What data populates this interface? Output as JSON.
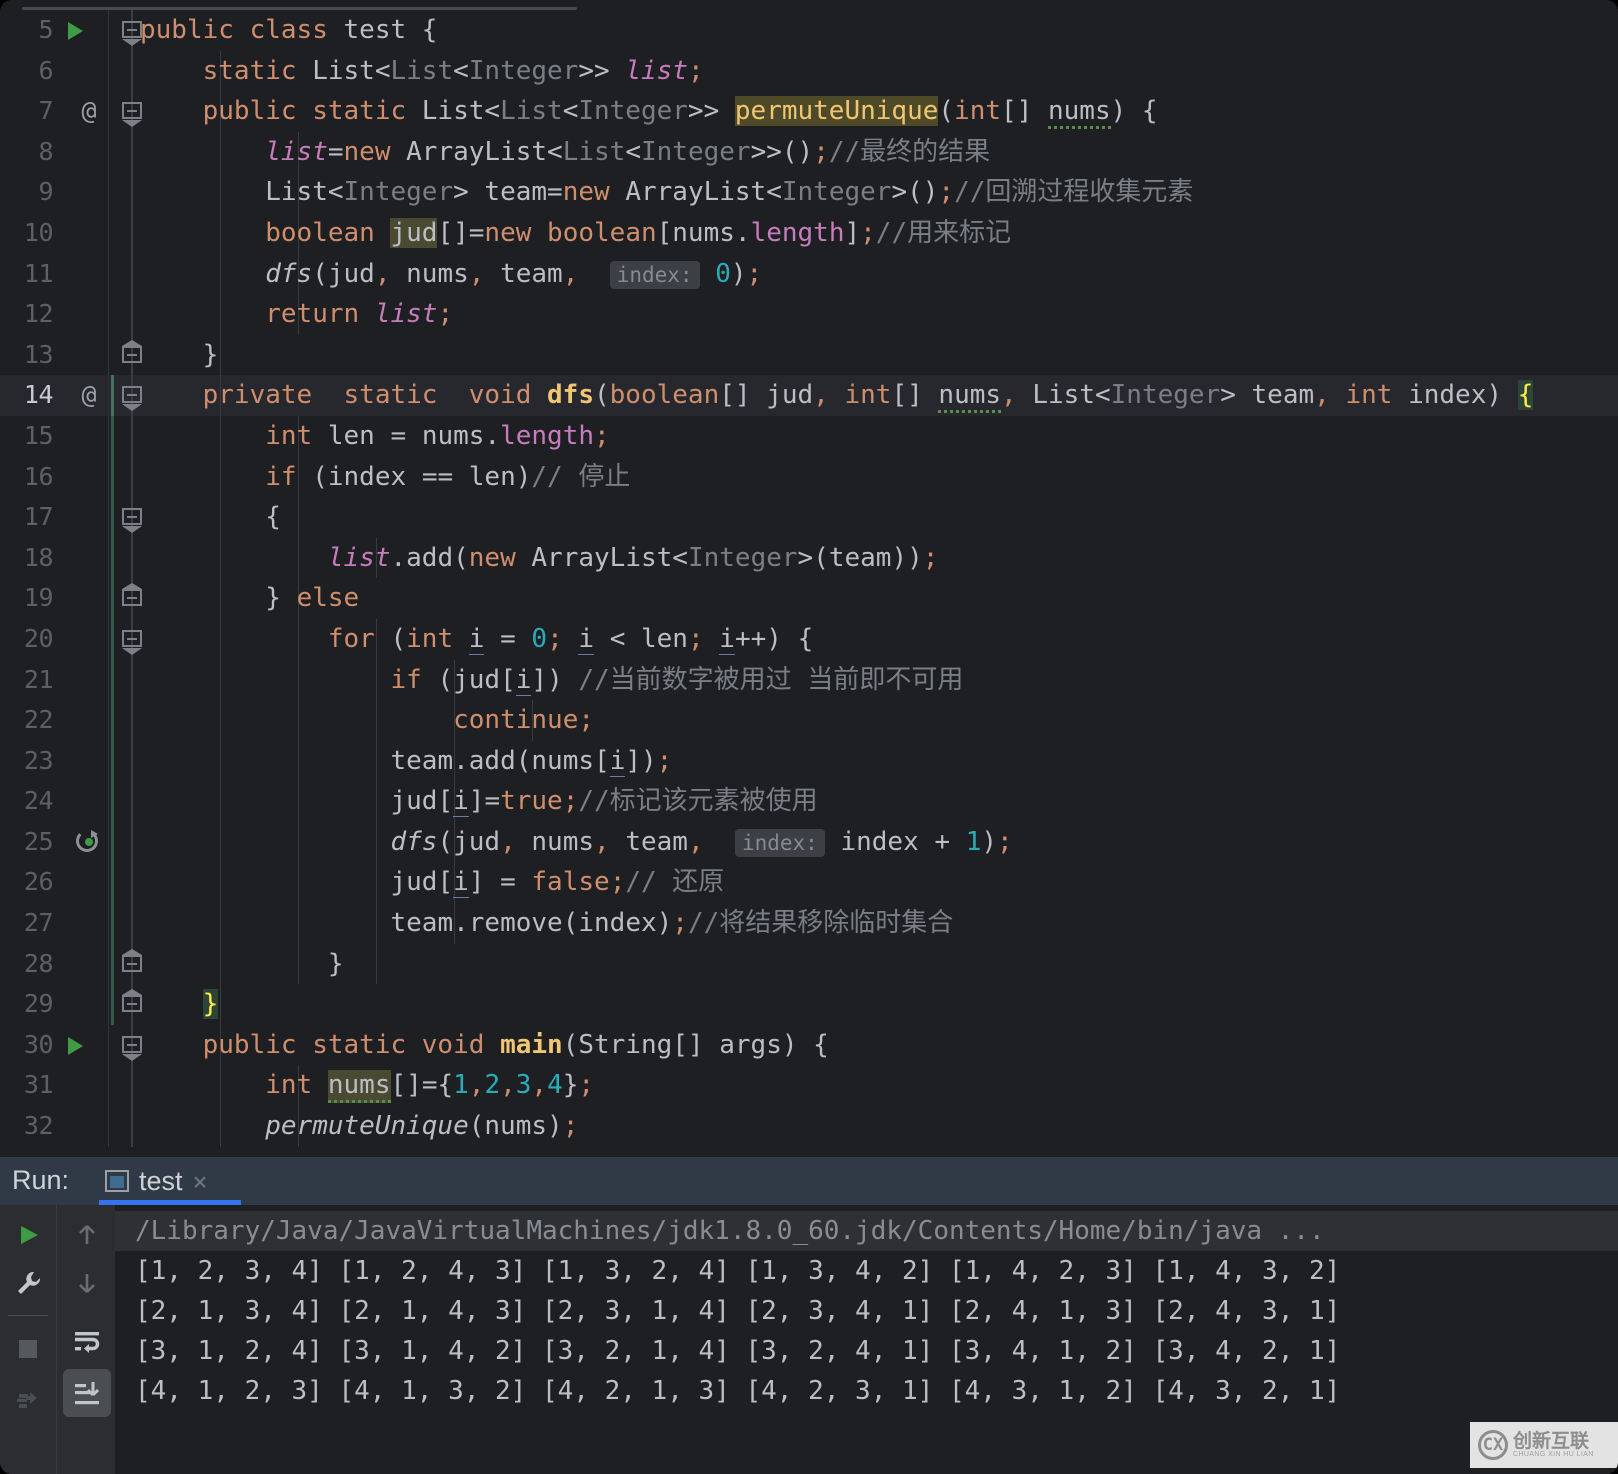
{
  "editor": {
    "first_visible_line": 5,
    "highlighted_line": 14,
    "lines": [
      {
        "n": "5",
        "marker": "run",
        "fold": "open",
        "text": "public class test {"
      },
      {
        "n": "6",
        "marker": "",
        "fold": "",
        "text": "    static List<List<Integer>> list;"
      },
      {
        "n": "7",
        "marker": "@",
        "fold": "open",
        "text": "    public static List<List<Integer>> permuteUnique(int[] nums) {"
      },
      {
        "n": "8",
        "marker": "",
        "fold": "",
        "text": "        list=new ArrayList<List<Integer>>();//最终的结果"
      },
      {
        "n": "9",
        "marker": "",
        "fold": "",
        "text": "        List<Integer> team=new ArrayList<Integer>();//回溯过程收集元素"
      },
      {
        "n": "10",
        "marker": "",
        "fold": "",
        "text": "        boolean jud[]=new boolean[nums.length];//用来标记"
      },
      {
        "n": "11",
        "marker": "",
        "fold": "",
        "text": "        dfs(jud, nums, team,  index: 0);"
      },
      {
        "n": "12",
        "marker": "",
        "fold": "",
        "text": "        return list;"
      },
      {
        "n": "13",
        "marker": "",
        "fold": "close",
        "text": "    }"
      },
      {
        "n": "14",
        "marker": "@",
        "fold": "open",
        "text": "    private  static  void dfs(boolean[] jud, int[] nums, List<Integer> team, int index) {"
      },
      {
        "n": "15",
        "marker": "",
        "fold": "",
        "text": "        int len = nums.length;"
      },
      {
        "n": "16",
        "marker": "",
        "fold": "",
        "text": "        if (index == len)// 停止"
      },
      {
        "n": "17",
        "marker": "",
        "fold": "open",
        "text": "        {"
      },
      {
        "n": "18",
        "marker": "",
        "fold": "",
        "text": "            list.add(new ArrayList<Integer>(team));"
      },
      {
        "n": "19",
        "marker": "",
        "fold": "close",
        "text": "        } else"
      },
      {
        "n": "20",
        "marker": "",
        "fold": "open",
        "text": "            for (int i = 0; i < len; i++) {"
      },
      {
        "n": "21",
        "marker": "",
        "fold": "",
        "text": "                if (jud[i]) //当前数字被用过 当前即不可用"
      },
      {
        "n": "22",
        "marker": "",
        "fold": "",
        "text": "                    continue;"
      },
      {
        "n": "23",
        "marker": "",
        "fold": "",
        "text": "                team.add(nums[i]);"
      },
      {
        "n": "24",
        "marker": "",
        "fold": "",
        "text": "                jud[i]=true;//标记该元素被使用"
      },
      {
        "n": "25",
        "marker": "recursion",
        "fold": "",
        "text": "                dfs(jud, nums, team,  index: index + 1);"
      },
      {
        "n": "26",
        "marker": "",
        "fold": "",
        "text": "                jud[i] = false;// 还原"
      },
      {
        "n": "27",
        "marker": "",
        "fold": "",
        "text": "                team.remove(index);//将结果移除临时集合"
      },
      {
        "n": "28",
        "marker": "",
        "fold": "close",
        "text": "            }"
      },
      {
        "n": "29",
        "marker": "",
        "fold": "close",
        "text": "    }"
      },
      {
        "n": "30",
        "marker": "run",
        "fold": "open",
        "text": "    public static void main(String[] args) {"
      },
      {
        "n": "31",
        "marker": "",
        "fold": "",
        "text": "        int nums[]={1,2,3,4};"
      },
      {
        "n": "32",
        "marker": "",
        "fold": "",
        "text": "        permuteUnique(nums);"
      }
    ],
    "inlay_hints": [
      "index:",
      "index:"
    ]
  },
  "run_panel": {
    "label": "Run:",
    "tab_name": "test",
    "tab_close": "×",
    "toolbar_left": [
      "rerun-icon",
      "wrench-icon",
      "stop-icon",
      "print-icon"
    ],
    "toolbar_mid": [
      "arrow-up-icon",
      "arrow-down-icon",
      "soft-wrap-icon",
      "scroll-to-end-icon"
    ],
    "console": {
      "command": "/Library/Java/JavaVirtualMachines/jdk1.8.0_60.jdk/Contents/Home/bin/java ...",
      "output_lines": [
        "[1, 2, 3, 4] [1, 2, 4, 3] [1, 3, 2, 4] [1, 3, 4, 2] [1, 4, 2, 3] [1, 4, 3, 2]",
        "[2, 1, 3, 4] [2, 1, 4, 3] [2, 3, 1, 4] [2, 3, 4, 1] [2, 4, 1, 3] [2, 4, 3, 1]",
        "[3, 1, 2, 4] [3, 1, 4, 2] [3, 2, 1, 4] [3, 2, 4, 1] [3, 4, 1, 2] [3, 4, 2, 1]",
        "[4, 1, 2, 3] [4, 1, 3, 2] [4, 2, 1, 3] [4, 2, 3, 1] [4, 3, 1, 2] [4, 3, 2, 1]"
      ]
    }
  },
  "watermark": {
    "logo": "CX",
    "cn": "创新互联",
    "en": "CHUANG XIN HU LIAN"
  },
  "colors": {
    "editor_bg": "#1e1f22",
    "panel_bg": "#2b2d30",
    "run_header_bg": "#303a46",
    "accent": "#3574f0",
    "keyword": "#cf8e6d",
    "field": "#c77dbb",
    "number": "#2aacb8",
    "comment": "#7a7e85",
    "method": "#f0c674",
    "text": "#bcbec4"
  }
}
